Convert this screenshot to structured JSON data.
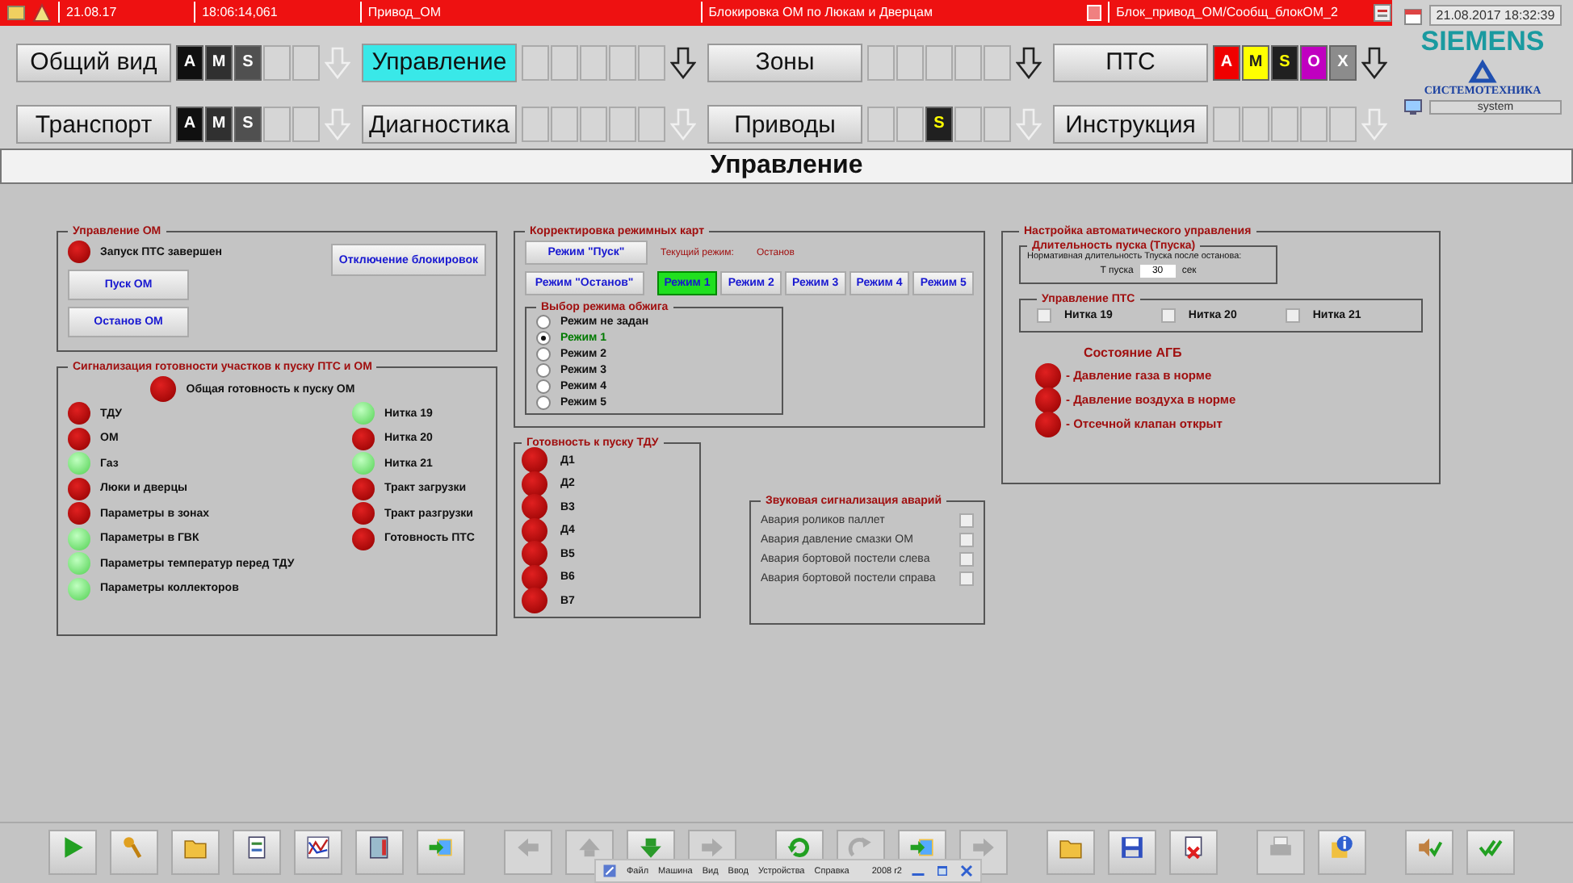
{
  "alarm_bar": {
    "date": "21.08.17",
    "time": "18:06:14,061",
    "source": "Привод_ОМ",
    "message": "Блокировка ОМ по Люкам и Дверцам",
    "tag": "Блок_привод_ОМ/Сообщ_блокОМ_2"
  },
  "clock": "21.08.2017 18:32:39",
  "logo": {
    "brand": "SIEMENS",
    "subtitle": "СИСТЕМОТЕХНИКА"
  },
  "user": "system",
  "nav_rows": [
    [
      {
        "label": "Общий вид",
        "selected": false,
        "arrow_enabled": false,
        "slots": [
          {
            "kind": "letter",
            "text": "A",
            "color": "#101010"
          },
          {
            "kind": "letter",
            "text": "M",
            "color": "#303030"
          },
          {
            "kind": "letter",
            "text": "S",
            "color": "#505050"
          },
          {
            "kind": "empty"
          },
          {
            "kind": "empty"
          }
        ]
      },
      {
        "label": "Управление",
        "selected": true,
        "arrow_enabled": true,
        "slots": [
          {
            "kind": "empty"
          },
          {
            "kind": "empty"
          },
          {
            "kind": "empty"
          },
          {
            "kind": "empty"
          },
          {
            "kind": "empty"
          }
        ]
      },
      {
        "label": "Зоны",
        "selected": false,
        "arrow_enabled": true,
        "slots": [
          {
            "kind": "empty"
          },
          {
            "kind": "empty"
          },
          {
            "kind": "empty"
          },
          {
            "kind": "empty"
          },
          {
            "kind": "empty"
          }
        ]
      },
      {
        "label": "ПТС",
        "selected": false,
        "arrow_enabled": true,
        "slots": [
          {
            "kind": "letter",
            "text": "A",
            "color": "#f00000"
          },
          {
            "kind": "letter",
            "text": "M",
            "color": "#ffff00"
          },
          {
            "kind": "lit",
            "text": "S",
            "color": "#202020"
          },
          {
            "kind": "letter",
            "text": "O",
            "color": "#c000c0"
          },
          {
            "kind": "letter",
            "text": "X",
            "color": "#8c8c8c"
          }
        ]
      }
    ],
    [
      {
        "label": "Транспорт",
        "selected": false,
        "arrow_enabled": false,
        "slots": [
          {
            "kind": "letter",
            "text": "A",
            "color": "#101010"
          },
          {
            "kind": "letter",
            "text": "M",
            "color": "#303030"
          },
          {
            "kind": "letter",
            "text": "S",
            "color": "#505050"
          },
          {
            "kind": "empty"
          },
          {
            "kind": "empty"
          }
        ]
      },
      {
        "label": "Диагностика",
        "selected": false,
        "arrow_enabled": false,
        "slots": [
          {
            "kind": "empty"
          },
          {
            "kind": "empty"
          },
          {
            "kind": "empty"
          },
          {
            "kind": "empty"
          },
          {
            "kind": "empty"
          }
        ]
      },
      {
        "label": "Приводы",
        "selected": false,
        "arrow_enabled": false,
        "slots": [
          {
            "kind": "empty"
          },
          {
            "kind": "empty"
          },
          {
            "kind": "lit",
            "text": "S",
            "color": "#202020"
          },
          {
            "kind": "empty"
          },
          {
            "kind": "empty"
          }
        ]
      },
      {
        "label": "Инструкция",
        "selected": false,
        "arrow_enabled": false,
        "slots": [
          {
            "kind": "empty"
          },
          {
            "kind": "empty"
          },
          {
            "kind": "empty"
          },
          {
            "kind": "empty"
          },
          {
            "kind": "empty"
          }
        ]
      }
    ]
  ],
  "page_title": "Управление",
  "om_control": {
    "title": "Управление ОМ",
    "lamp": {
      "label": "Запуск ПТС завершен",
      "ok": false
    },
    "buttons": [
      "Пуск ОМ",
      "Останов ОМ"
    ],
    "unlock_button": "Отключение блокировок"
  },
  "readiness": {
    "title": "Сигнализация готовности участков к пуску ПТС и ОМ",
    "overall": {
      "label": "Общая готовность к пуску ОМ",
      "ok": false
    },
    "left": [
      {
        "label": "ТДУ",
        "ok": false
      },
      {
        "label": "ОМ",
        "ok": false
      },
      {
        "label": "Газ",
        "ok": true
      },
      {
        "label": "Люки и дверцы",
        "ok": false
      },
      {
        "label": "Параметры в зонах",
        "ok": false
      },
      {
        "label": "Параметры в ГВК",
        "ok": true
      },
      {
        "label": "Параметры температур перед ТДУ",
        "ok": true
      },
      {
        "label": "Параметры коллекторов",
        "ok": true
      }
    ],
    "right": [
      {
        "label": "Нитка 19",
        "ok": true
      },
      {
        "label": "Нитка 20",
        "ok": false
      },
      {
        "label": "Нитка 21",
        "ok": true
      },
      {
        "label": "Тракт загрузки",
        "ok": false
      },
      {
        "label": "Тракт разгрузки",
        "ok": false
      },
      {
        "label": "Готовность ПТС",
        "ok": false
      }
    ]
  },
  "modes": {
    "title": "Корректировка режимных карт",
    "start_button": "Режим \"Пуск\"",
    "stop_button": "Режим \"Останов\"",
    "current_label": "Текущий режим:",
    "current_value": "Останов",
    "mode_buttons": [
      {
        "label": "Режим 1",
        "selected": true
      },
      {
        "label": "Режим 2",
        "selected": false
      },
      {
        "label": "Режим 3",
        "selected": false
      },
      {
        "label": "Режим 4",
        "selected": false
      },
      {
        "label": "Режим 5",
        "selected": false
      }
    ],
    "firing": {
      "title": "Выбор режима обжига",
      "options": [
        {
          "label": "Режим не задан",
          "selected": false
        },
        {
          "label": "Режим 1",
          "selected": true
        },
        {
          "label": "Режим 2",
          "selected": false
        },
        {
          "label": "Режим 3",
          "selected": false
        },
        {
          "label": "Режим 4",
          "selected": false
        },
        {
          "label": "Режим 5",
          "selected": false
        }
      ]
    }
  },
  "tdu": {
    "title": "Готовность к пуску ТДУ",
    "lamps": [
      {
        "label": "Д1",
        "ok": false
      },
      {
        "label": "Д2",
        "ok": false
      },
      {
        "label": "В3",
        "ok": false
      },
      {
        "label": "Д4",
        "ok": false
      },
      {
        "label": "В5",
        "ok": false
      },
      {
        "label": "В6",
        "ok": false
      },
      {
        "label": "В7",
        "ok": false
      }
    ]
  },
  "alarms": {
    "title": "Звуковая сигнализация аварий",
    "items": [
      {
        "label": "Авария роликов паллет",
        "checked": false
      },
      {
        "label": "Авария давление смазки ОМ",
        "checked": false
      },
      {
        "label": "Авария бортовой постели слева",
        "checked": false
      },
      {
        "label": "Авария бортовой постели справа",
        "checked": false
      }
    ]
  },
  "auto": {
    "title": "Настройка автоматического управления",
    "duration": {
      "title": "Длительность пуска (Тпуска)",
      "note": "Нормативная длительность Тпуска после останова:",
      "field_label": "Т пуска",
      "value": "30",
      "unit": "сек"
    },
    "pts": {
      "title": "Управление ПТС",
      "items": [
        {
          "label": "Нитка 19",
          "checked": false
        },
        {
          "label": "Нитка 20",
          "checked": false
        },
        {
          "label": "Нитка 21",
          "checked": false
        }
      ]
    },
    "agb": {
      "title": "Состояние АГБ",
      "lamps": [
        {
          "label": "- Давление газа в норме",
          "ok": false
        },
        {
          "label": "- Давление воздуха в норме",
          "ok": false
        },
        {
          "label": "- Отсечной клапан открыт",
          "ok": false
        }
      ]
    }
  },
  "toolbar": {
    "groups": [
      [
        {
          "kind": "play",
          "disabled": false
        },
        {
          "kind": "key",
          "disabled": false
        },
        {
          "kind": "folder",
          "disabled": false
        },
        {
          "kind": "document",
          "disabled": false
        },
        {
          "kind": "chart",
          "disabled": false
        },
        {
          "kind": "thermometer",
          "disabled": false
        },
        {
          "kind": "import",
          "disabled": false
        }
      ],
      [
        {
          "kind": "left",
          "disabled": true
        },
        {
          "kind": "up",
          "disabled": true
        },
        {
          "kind": "down",
          "disabled": false
        },
        {
          "kind": "right",
          "disabled": true
        }
      ],
      [
        {
          "kind": "refresh",
          "disabled": false
        },
        {
          "kind": "redo",
          "disabled": true
        },
        {
          "kind": "import",
          "disabled": false
        },
        {
          "kind": "right",
          "disabled": true
        }
      ],
      [
        {
          "kind": "folder",
          "disabled": false
        },
        {
          "kind": "save",
          "disabled": false
        },
        {
          "kind": "delete",
          "disabled": false
        }
      ],
      [
        {
          "kind": "print",
          "disabled": true
        },
        {
          "kind": "info",
          "disabled": false
        }
      ],
      [
        {
          "kind": "sound",
          "disabled": false
        },
        {
          "kind": "check",
          "disabled": false
        }
      ]
    ]
  },
  "vm_menu": {
    "items": [
      "Файл",
      "Машина",
      "Вид",
      "Ввод",
      "Устройства",
      "Справка"
    ],
    "version": "2008 r2"
  }
}
